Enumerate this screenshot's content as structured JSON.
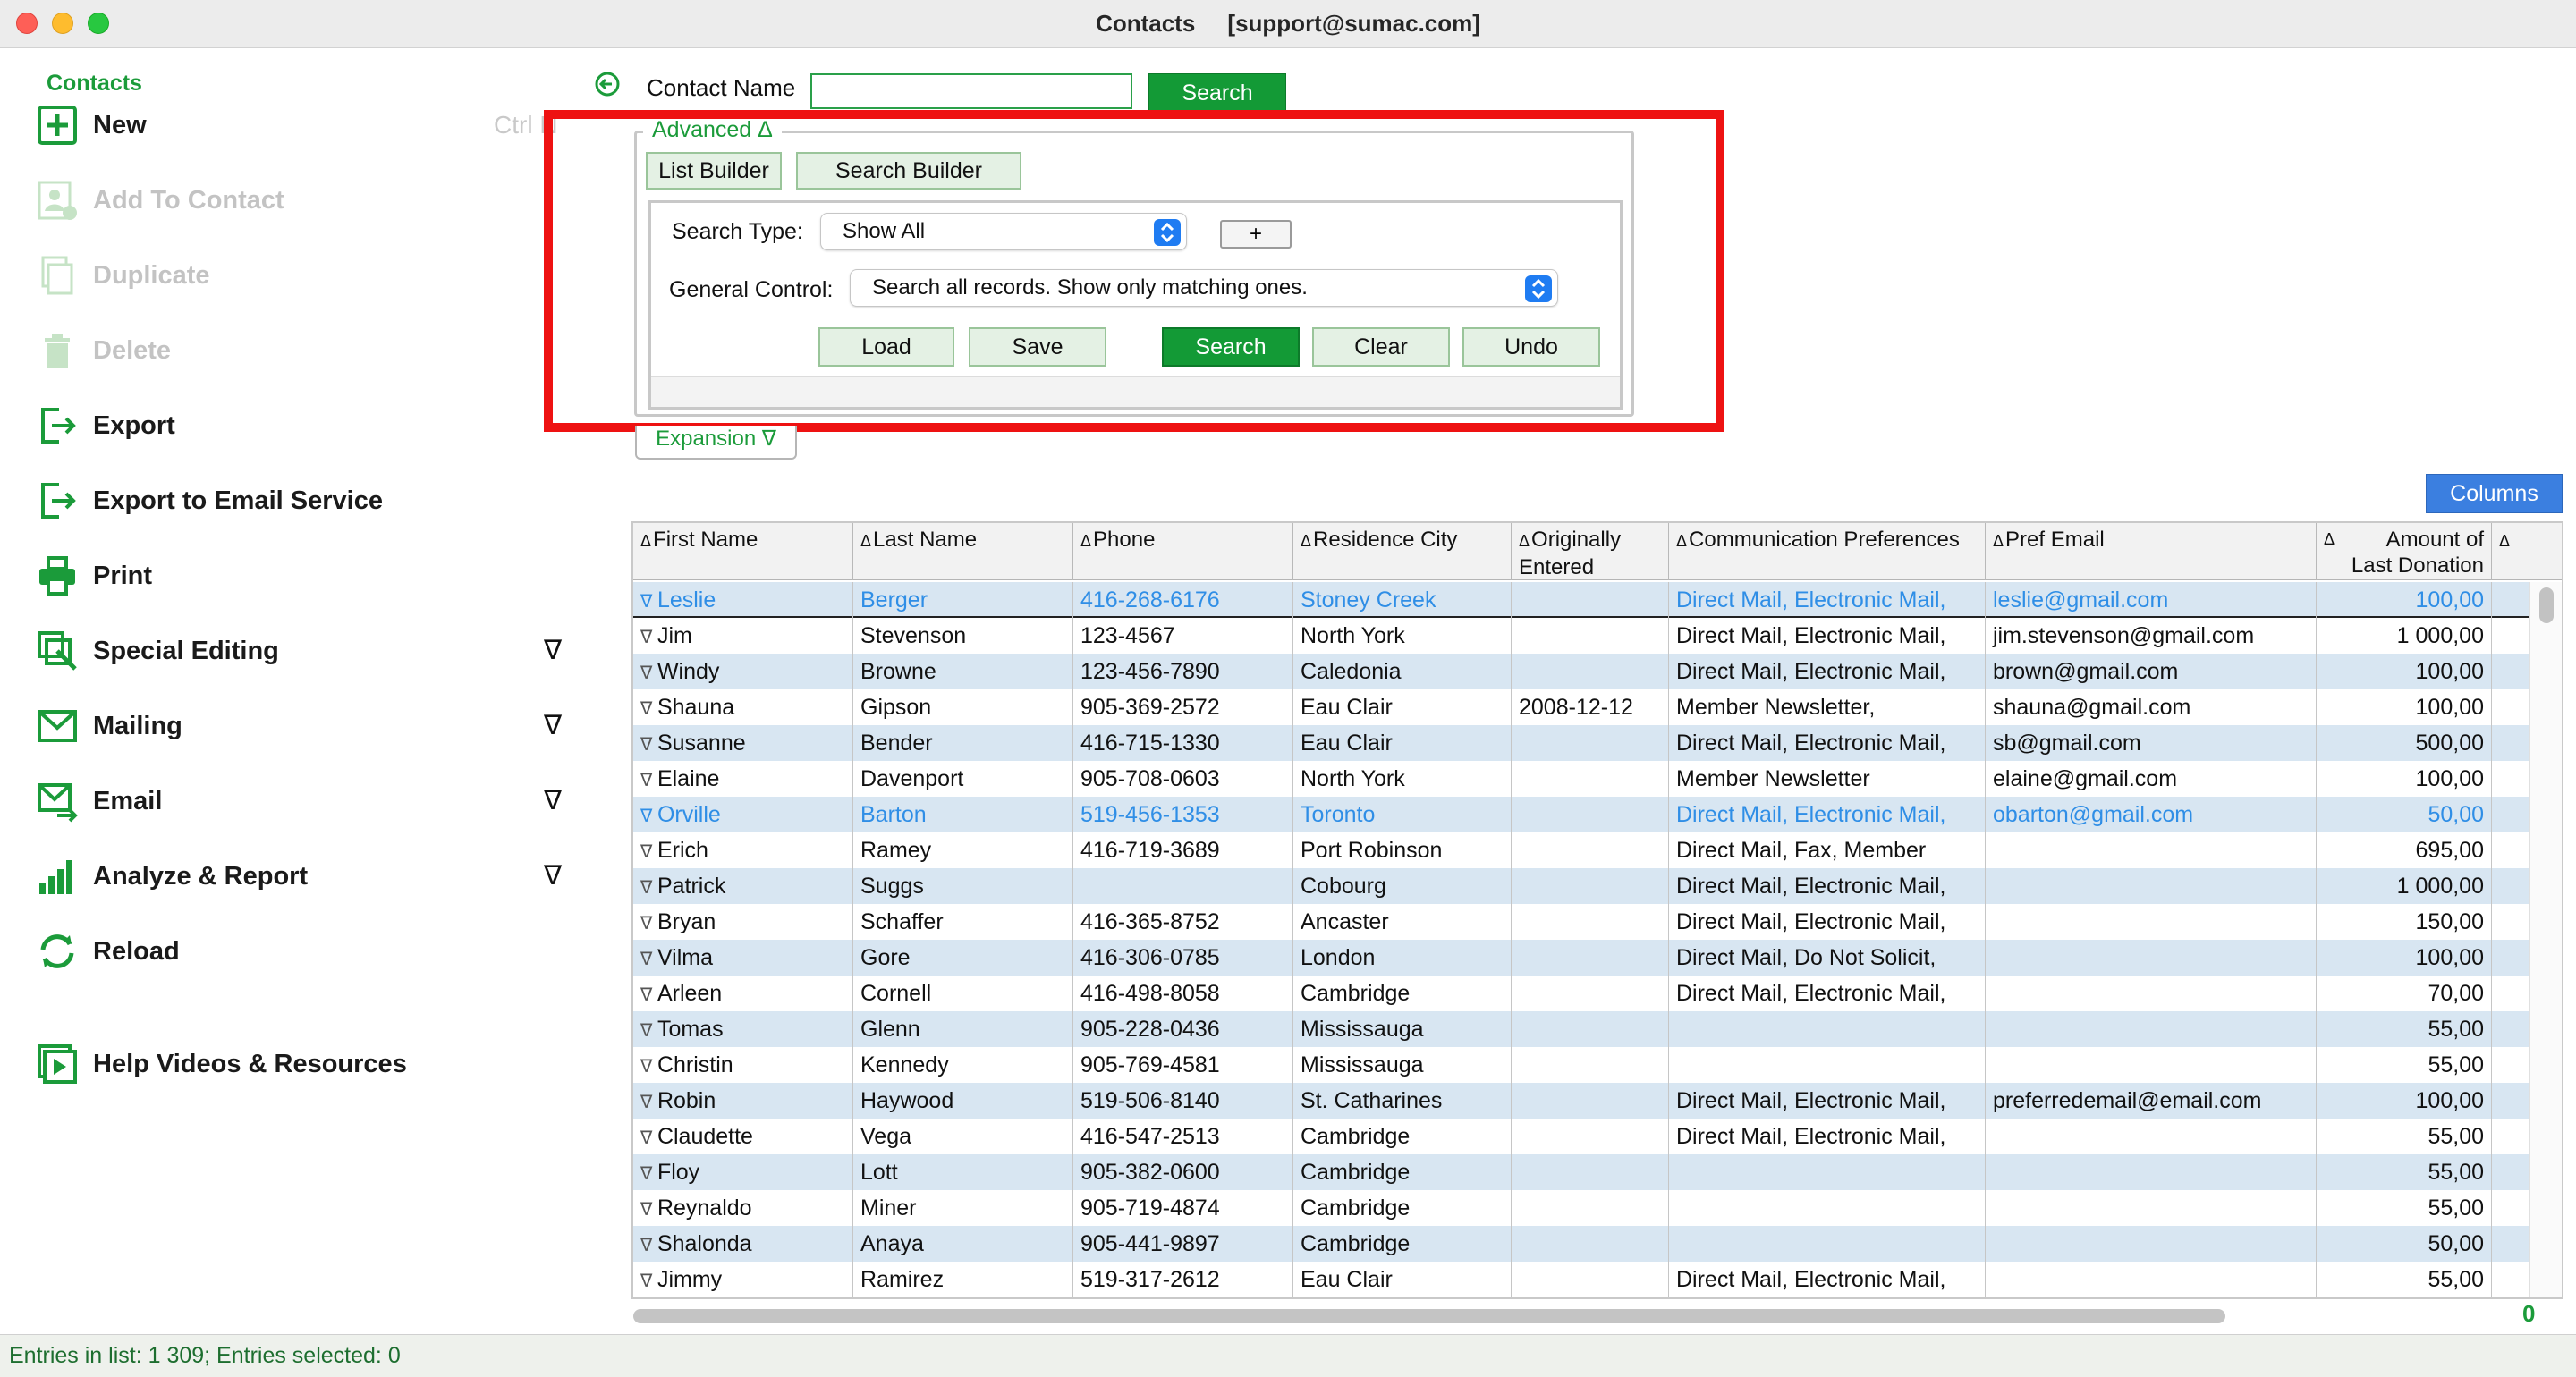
{
  "window": {
    "title": "Contacts     [support@sumac.com]"
  },
  "sidebar": {
    "header": "Contacts",
    "new_shortcut": "Ctrl N",
    "items": [
      {
        "label": "New",
        "icon": "plus-square-icon",
        "disabled": false
      },
      {
        "label": "Add To Contact",
        "icon": "add-person-icon",
        "disabled": true
      },
      {
        "label": "Duplicate",
        "icon": "duplicate-icon",
        "disabled": true
      },
      {
        "label": "Delete",
        "icon": "trash-icon",
        "disabled": true
      },
      {
        "label": "Export",
        "icon": "export-icon",
        "disabled": false
      },
      {
        "label": "Export to Email Service",
        "icon": "export-email-icon",
        "disabled": false
      },
      {
        "label": "Print",
        "icon": "printer-icon",
        "disabled": false
      },
      {
        "label": "Special Editing",
        "icon": "special-edit-icon",
        "disabled": false
      },
      {
        "label": "Mailing",
        "icon": "envelope-icon",
        "disabled": false
      },
      {
        "label": "Email",
        "icon": "email-send-icon",
        "disabled": false
      },
      {
        "label": "Analyze & Report",
        "icon": "bar-chart-icon",
        "disabled": false
      },
      {
        "label": "Reload",
        "icon": "reload-icon",
        "disabled": false
      },
      {
        "label": "Help Videos & Resources",
        "icon": "video-icon",
        "disabled": false
      }
    ],
    "arrow_glyph": "∇"
  },
  "search": {
    "label": "Contact Name",
    "value": "",
    "button": "Search"
  },
  "advanced": {
    "legend": "Advanced Δ",
    "tabs": {
      "list_builder": "List Builder",
      "search_builder": "Search Builder"
    },
    "search_type_label": "Search Type:",
    "search_type_value": "Show All",
    "plus": "+",
    "general_control_label": "General Control:",
    "general_control_value": "Search all records. Show only matching ones.",
    "buttons": {
      "load": "Load",
      "save": "Save",
      "search": "Search",
      "clear": "Clear",
      "undo": "Undo"
    }
  },
  "expansion": "Expansion ∇",
  "columns_button": "Columns",
  "table": {
    "headers": [
      {
        "label": "First Name"
      },
      {
        "label": "Last Name"
      },
      {
        "label": "Phone"
      },
      {
        "label": "Residence City"
      },
      {
        "label": "Originally",
        "label2": "Entered"
      },
      {
        "label": "Communication Preferences"
      },
      {
        "label": "Pref Email"
      },
      {
        "label": "Amount of",
        "label2": "Last Donation"
      },
      {
        "label": ""
      }
    ],
    "rows": [
      {
        "first": "Leslie",
        "last": "Berger",
        "phone": "416-268-6176",
        "city": "Stoney Creek",
        "entered": "",
        "comm": "Direct Mail, Electronic Mail,",
        "email": "leslie@gmail.com",
        "amount": "100,00",
        "link": true
      },
      {
        "first": "Jim",
        "last": "Stevenson",
        "phone": "123-4567",
        "city": "North York",
        "entered": "",
        "comm": "Direct Mail, Electronic Mail,",
        "email": "jim.stevenson@gmail.com",
        "amount": "1 000,00",
        "link": false
      },
      {
        "first": "Windy",
        "last": "Browne",
        "phone": "123-456-7890",
        "city": "Caledonia",
        "entered": "",
        "comm": "Direct Mail, Electronic Mail,",
        "email": "brown@gmail.com",
        "amount": "100,00",
        "link": false
      },
      {
        "first": "Shauna",
        "last": "Gipson",
        "phone": "905-369-2572",
        "city": "Eau Clair",
        "entered": "2008-12-12",
        "comm": "Member Newsletter,",
        "email": "shauna@gmail.com",
        "amount": "100,00",
        "link": false
      },
      {
        "first": "Susanne",
        "last": "Bender",
        "phone": "416-715-1330",
        "city": "Eau Clair",
        "entered": "",
        "comm": "Direct Mail, Electronic Mail,",
        "email": "sb@gmail.com",
        "amount": "500,00",
        "link": false
      },
      {
        "first": "Elaine",
        "last": "Davenport",
        "phone": "905-708-0603",
        "city": "North York",
        "entered": "",
        "comm": "Member Newsletter",
        "email": "elaine@gmail.com",
        "amount": "100,00",
        "link": false
      },
      {
        "first": "Orville",
        "last": "Barton",
        "phone": "519-456-1353",
        "city": "Toronto",
        "entered": "",
        "comm": "Direct Mail, Electronic Mail,",
        "email": "obarton@gmail.com",
        "amount": "50,00",
        "link": true
      },
      {
        "first": "Erich",
        "last": "Ramey",
        "phone": "416-719-3689",
        "city": "Port Robinson",
        "entered": "",
        "comm": "Direct Mail, Fax, Member",
        "email": "",
        "amount": "695,00",
        "link": false
      },
      {
        "first": "Patrick",
        "last": "Suggs",
        "phone": "",
        "city": "Cobourg",
        "entered": "",
        "comm": "Direct Mail, Electronic Mail,",
        "email": "",
        "amount": "1 000,00",
        "link": false
      },
      {
        "first": "Bryan",
        "last": "Schaffer",
        "phone": "416-365-8752",
        "city": "Ancaster",
        "entered": "",
        "comm": "Direct Mail, Electronic Mail,",
        "email": "",
        "amount": "150,00",
        "link": false
      },
      {
        "first": "Vilma",
        "last": "Gore",
        "phone": "416-306-0785",
        "city": "London",
        "entered": "",
        "comm": "Direct Mail, Do Not Solicit,",
        "email": "",
        "amount": "100,00",
        "link": false
      },
      {
        "first": "Arleen",
        "last": "Cornell",
        "phone": "416-498-8058",
        "city": "Cambridge",
        "entered": "",
        "comm": "Direct Mail, Electronic Mail,",
        "email": "",
        "amount": "70,00",
        "link": false
      },
      {
        "first": "Tomas",
        "last": "Glenn",
        "phone": "905-228-0436",
        "city": "Mississauga",
        "entered": "",
        "comm": "",
        "email": "",
        "amount": "55,00",
        "link": false
      },
      {
        "first": "Christin",
        "last": "Kennedy",
        "phone": "905-769-4581",
        "city": "Mississauga",
        "entered": "",
        "comm": "",
        "email": "",
        "amount": "55,00",
        "link": false
      },
      {
        "first": "Robin",
        "last": "Haywood",
        "phone": "519-506-8140",
        "city": "St. Catharines",
        "entered": "",
        "comm": "Direct Mail, Electronic Mail,",
        "email": "preferredemail@email.com",
        "amount": "100,00",
        "link": false
      },
      {
        "first": "Claudette",
        "last": "Vega",
        "phone": "416-547-2513",
        "city": "Cambridge",
        "entered": "",
        "comm": "Direct Mail, Electronic Mail,",
        "email": "",
        "amount": "55,00",
        "link": false
      },
      {
        "first": "Floy",
        "last": "Lott",
        "phone": "905-382-0600",
        "city": "Cambridge",
        "entered": "",
        "comm": "",
        "email": "",
        "amount": "55,00",
        "link": false
      },
      {
        "first": "Reynaldo",
        "last": "Miner",
        "phone": "905-719-4874",
        "city": "Cambridge",
        "entered": "",
        "comm": "",
        "email": "",
        "amount": "55,00",
        "link": false
      },
      {
        "first": "Shalonda",
        "last": "Anaya",
        "phone": "905-441-9897",
        "city": "Cambridge",
        "entered": "",
        "comm": "",
        "email": "",
        "amount": "50,00",
        "link": false
      },
      {
        "first": "Jimmy",
        "last": "Ramirez",
        "phone": "519-317-2612",
        "city": "Eau Clair",
        "entered": "",
        "comm": "Direct Mail, Electronic Mail,",
        "email": "",
        "amount": "55,00",
        "link": false
      }
    ]
  },
  "scroll_corner": "0",
  "status": "Entries in list: 1 309; Entries selected: 0",
  "colors": {
    "accent_green": "#139a36",
    "link_blue": "#2f8ee6",
    "highlight_red": "#ee1212",
    "columns_blue": "#3b7fe0"
  }
}
